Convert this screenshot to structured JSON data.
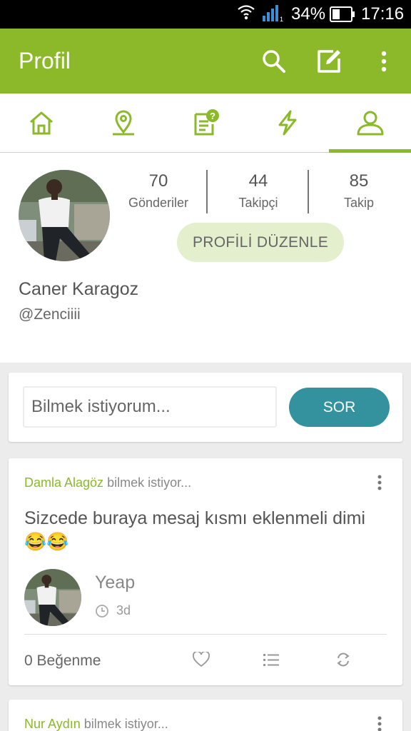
{
  "status_bar": {
    "battery": "34%",
    "time": "17:16",
    "icons": [
      "wifi-icon",
      "signal-icon",
      "battery-icon"
    ]
  },
  "app_bar": {
    "title": "Profil",
    "actions": [
      "search-icon",
      "compose-icon",
      "more-vert-icon"
    ]
  },
  "tabs": {
    "items": [
      "home-icon",
      "location-icon",
      "questions-icon",
      "activity-icon",
      "profile-icon"
    ],
    "active_index": 4
  },
  "profile": {
    "stats": [
      {
        "value": "70",
        "label": "Gönderiler"
      },
      {
        "value": "44",
        "label": "Takipçi"
      },
      {
        "value": "85",
        "label": "Takip"
      }
    ],
    "edit_button": "PROFİLİ DÜZENLE",
    "name": "Caner Karagoz",
    "handle": "@Zenciiii"
  },
  "ask": {
    "placeholder": "Bilmek istiyorum...",
    "button": "SOR"
  },
  "posts": [
    {
      "asker": "Damla Alagöz",
      "suffix": "bilmek istiyor...",
      "question": "Sizcede buraya mesaj kısmı eklenmeli dimi 😂😂",
      "answer": "Yeap",
      "time": "3d",
      "likes": "0 Beğenme"
    },
    {
      "asker": "Nur Aydın",
      "suffix": "bilmek istiyor..."
    }
  ],
  "colors": {
    "primary": "#8bb929",
    "accent_button": "#34929f",
    "edit_button_bg": "#e3efcd"
  }
}
